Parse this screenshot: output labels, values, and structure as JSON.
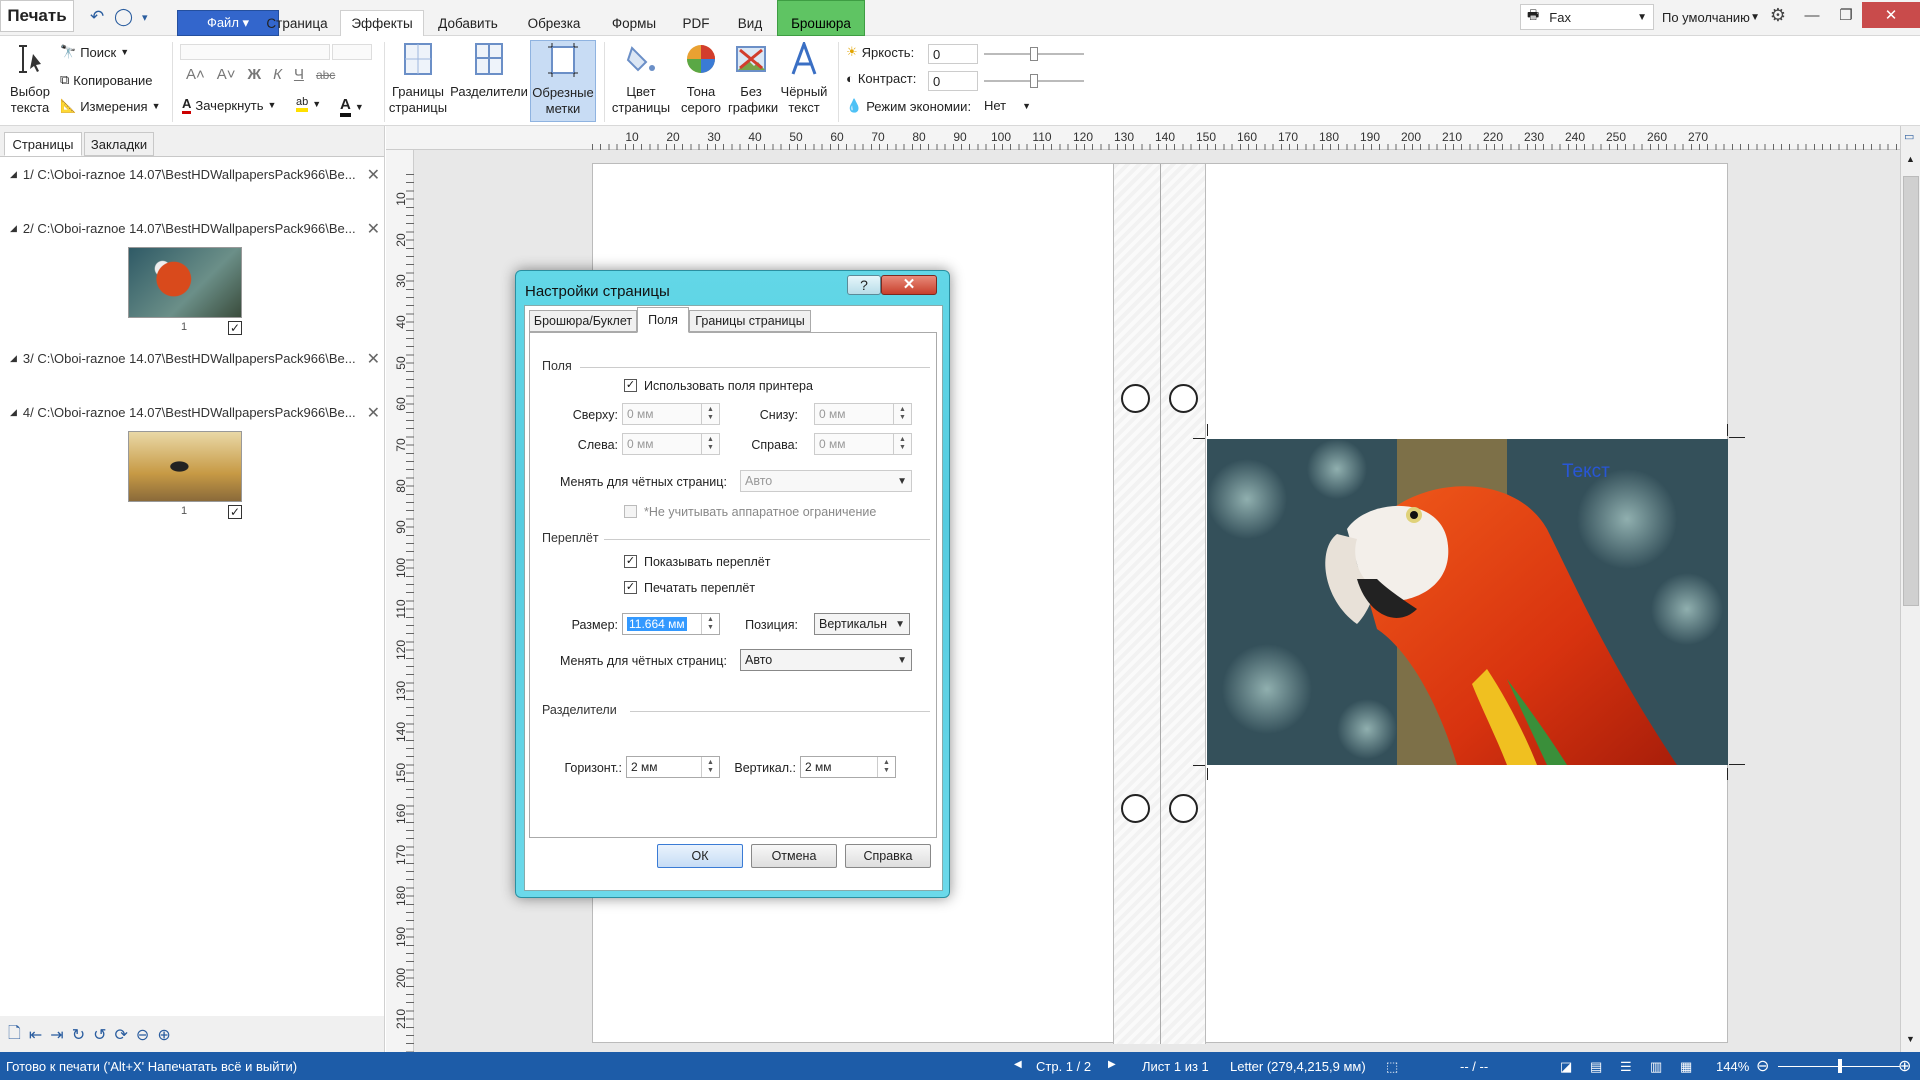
{
  "menubar": {
    "print_label": "Печать",
    "file_label": "Файл ▾",
    "tabs": [
      "Страница",
      "Эффекты",
      "Добавить",
      "Обрезка",
      "Формы",
      "PDF",
      "Вид",
      "Брошюра"
    ],
    "printer": "Fax",
    "profile": "По умолчанию"
  },
  "ribbon": {
    "select_text": "Выбор\nтекста",
    "search": "Поиск",
    "copy": "Копирование",
    "measure": "Измерения",
    "strike": "Зачеркнуть",
    "page_borders": "Границы\nстраницы",
    "separators": "Разделители",
    "crop_marks": "Обрезные\nметки",
    "page_color": "Цвет\nстраницы",
    "gray_tones": "Тона\nсерого",
    "no_graphics": "Без\nграфики",
    "black_text": "Чёрный\nтекст",
    "brightness_label": "Яркость:",
    "brightness_value": "0",
    "contrast_label": "Контраст:",
    "contrast_value": "0",
    "economy_label": "Режим экономии:",
    "economy_value": "Нет"
  },
  "left_panel": {
    "tabs": [
      "Страницы",
      "Закладки"
    ],
    "pages": [
      {
        "title": "1/ C:\\Oboi-raznoe 14.07\\BestHDWallpapersPack966\\Be..."
      },
      {
        "title": "2/ C:\\Oboi-raznoe 14.07\\BestHDWallpapersPack966\\Be...",
        "thumb_num": "1",
        "check": "✓"
      },
      {
        "title": "3/ C:\\Oboi-raznoe 14.07\\BestHDWallpapersPack966\\Be..."
      },
      {
        "title": "4/ C:\\Oboi-raznoe 14.07\\BestHDWallpapersPack966\\Be...",
        "thumb_num": "1",
        "check": "✓"
      }
    ]
  },
  "ruler_top": [
    "10",
    "20",
    "30",
    "40",
    "50",
    "60",
    "70",
    "80",
    "90",
    "100",
    "110",
    "120",
    "130",
    "140",
    "150",
    "160",
    "170",
    "180",
    "190",
    "200",
    "210",
    "220",
    "230",
    "240",
    "250",
    "260",
    "270"
  ],
  "ruler_left": [
    "10",
    "20",
    "30",
    "40",
    "50",
    "60",
    "70",
    "80",
    "90",
    "100",
    "110",
    "120",
    "130",
    "140",
    "150",
    "160",
    "170",
    "180",
    "190",
    "200",
    "210"
  ],
  "document": {
    "photo_text": "Текст"
  },
  "dialog": {
    "title": "Настройки страницы",
    "help": "?",
    "close": "✕",
    "tabs": [
      "Брошюра/Буклет",
      "Поля",
      "Границы страницы"
    ],
    "fields_group": "Поля",
    "use_printer_fields": "Использовать поля принтера",
    "top_label": "Сверху:",
    "top_value": "0 мм",
    "bottom_label": "Снизу:",
    "bottom_value": "0 мм",
    "left_label": "Слева:",
    "left_value": "0 мм",
    "right_label": "Справа:",
    "right_value": "0 мм",
    "even_pages_label": "Менять для чётных страниц:",
    "even_pages_value": "Авто",
    "ignore_hw": "*Не учитывать аппаратное ограничение",
    "binding_group": "Переплёт",
    "show_binding": "Показывать переплёт",
    "print_binding": "Печатать переплёт",
    "size_label": "Размер:",
    "size_value": "11.664 мм",
    "position_label": "Позиция:",
    "position_value": "Вертикальн",
    "even_pages2_label": "Менять для чётных страниц:",
    "even_pages2_value": "Авто",
    "separators_group": "Разделители",
    "horiz_label": "Горизонт.:",
    "horiz_value": "2 мм",
    "vert_label": "Вертикал.:",
    "vert_value": "2 мм",
    "ok": "ОК",
    "cancel": "Отмена",
    "help_btn": "Справка"
  },
  "statusbar": {
    "ready": "Готово к печати ('Alt+X' Напечатать всё и выйти)",
    "page": "Стр. 1 / 2",
    "sheet": "Лист 1 из 1",
    "paper": "Letter (279,4,215,9 мм)",
    "pos": "-- / --",
    "zoom": "144%"
  }
}
